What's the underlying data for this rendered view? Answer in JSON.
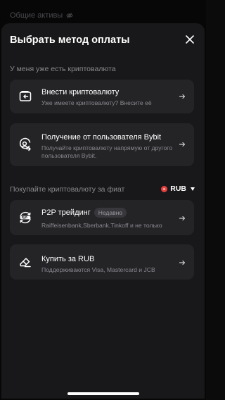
{
  "background": {
    "assets_label": "Общие активы",
    "eye_icon": "eye-off-icon"
  },
  "sheet": {
    "title": "Выбрать метод оплаты",
    "close_icon": "close-icon",
    "section_have_crypto": "У меня уже есть криптовалюта",
    "section_buy_fiat": "Покупайте криптовалюту за фиат",
    "currency": {
      "code": "RUB",
      "flag_color": "#e6413f"
    },
    "options": [
      {
        "title": "Внести криптовалюту",
        "subtitle": "Уже имеете криптовалюту? Внесите её",
        "icon": "wallet-deposit-icon"
      },
      {
        "title": "Получение от пользователя Bybit",
        "subtitle": "Получайте криптовалюту напрямую от другого пользователя Bybit.",
        "icon": "user-transfer-icon"
      },
      {
        "title": "P2P трейдинг",
        "badge": "Недавно",
        "subtitle": "Raiffeisenbank,Sberbank,Tinkoff и не только",
        "icon": "p2p-icon"
      },
      {
        "title": "Купить за RUB",
        "subtitle": "Поддерживаются Visa, Mastercard и JCB",
        "icon": "card-buy-icon"
      }
    ]
  },
  "colors": {
    "sheet_bg": "#18181a",
    "card_bg": "#242427",
    "muted_text": "#8a8a8f"
  }
}
